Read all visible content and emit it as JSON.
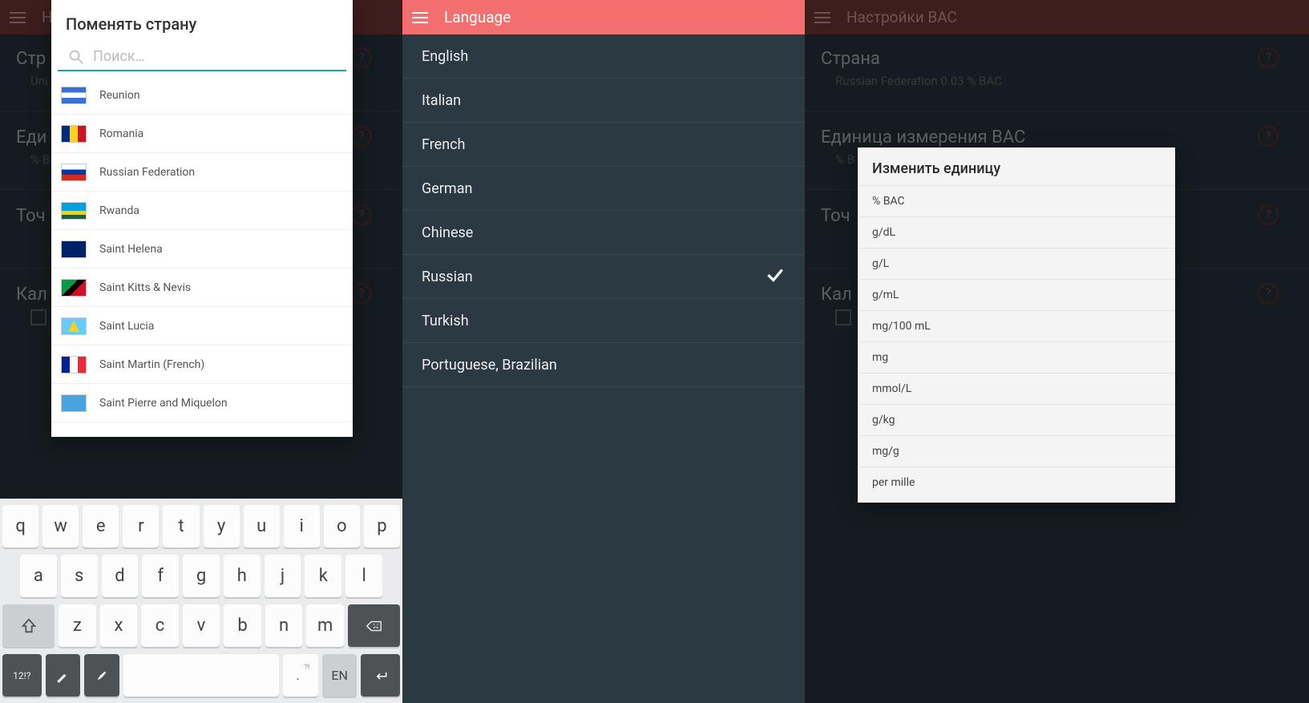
{
  "screen1": {
    "appbar_title": "Н",
    "dialog_title": "Поменять страну",
    "search_placeholder": "Поиск…",
    "countries": [
      "Reunion",
      "Romania",
      "Russian Federation",
      "Rwanda",
      "Saint Helena",
      "Saint Kitts & Nevis",
      "Saint Lucia",
      "Saint Martin (French)",
      "Saint Pierre and Miquelon"
    ],
    "bg": {
      "country_title": "Стр",
      "country_sub": "Uni",
      "unit_title": "Еди",
      "unit_sub": "% B",
      "precision_title": "Точ",
      "calc_title": "Кал"
    },
    "keyboard": {
      "row1": [
        "q",
        "w",
        "e",
        "r",
        "t",
        "y",
        "u",
        "i",
        "o",
        "p"
      ],
      "row2": [
        "a",
        "s",
        "d",
        "f",
        "g",
        "h",
        "j",
        "k",
        "l"
      ],
      "row3": [
        "z",
        "x",
        "c",
        "v",
        "b",
        "n",
        "m"
      ],
      "num_key": "12!?",
      "lang_key": "EN",
      "dot_key": ".",
      "dot_sup": "?!"
    }
  },
  "screen2": {
    "appbar_title": "Language",
    "languages": [
      "English",
      "Italian",
      "French",
      "German",
      "Chinese",
      "Russian",
      "Turkish",
      "Portuguese, Brazilian"
    ],
    "selected_index": 5
  },
  "screen3": {
    "appbar_title": "Настройки BAC",
    "bg": {
      "country_title": "Страна",
      "country_sub": "Russian Federation 0.03 % BAC",
      "unit_title": "Единица измерения BAC",
      "unit_sub": "% B",
      "precision_title": "Точ",
      "calc_title": "Кал"
    },
    "dialog_title": "Изменить единицу",
    "units": [
      "% BAC",
      "g/dL",
      "g/L",
      "g/mL",
      "mg/100 mL",
      "mg",
      "mmol/L",
      "g/kg",
      "mg/g",
      "per mille"
    ]
  }
}
